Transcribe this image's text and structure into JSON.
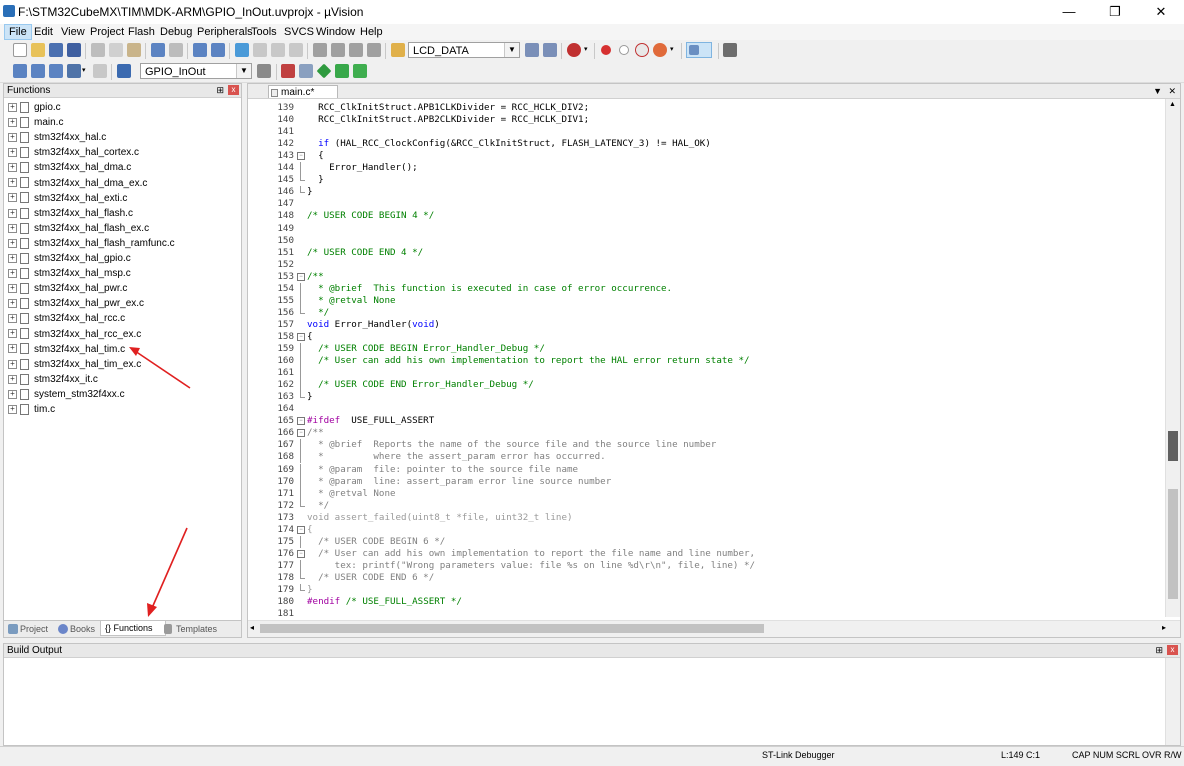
{
  "window": {
    "title": "F:\\STM32CubeMX\\TIM\\MDK-ARM\\GPIO_InOut.uvprojx - µVision",
    "minimize": "—",
    "maximize": "❐",
    "close": "✕"
  },
  "menu": [
    "File",
    "Edit",
    "View",
    "Project",
    "Flash",
    "Debug",
    "Peripherals",
    "Tools",
    "SVCS",
    "Window",
    "Help"
  ],
  "toolbar1": {
    "combo_value": "LCD_DATA"
  },
  "toolbar2": {
    "target_value": "GPIO_InOut"
  },
  "functions_panel": {
    "title": "Functions",
    "pin": "⊞",
    "close": "x",
    "files": [
      "gpio.c",
      "main.c",
      "stm32f4xx_hal.c",
      "stm32f4xx_hal_cortex.c",
      "stm32f4xx_hal_dma.c",
      "stm32f4xx_hal_dma_ex.c",
      "stm32f4xx_hal_exti.c",
      "stm32f4xx_hal_flash.c",
      "stm32f4xx_hal_flash_ex.c",
      "stm32f4xx_hal_flash_ramfunc.c",
      "stm32f4xx_hal_gpio.c",
      "stm32f4xx_hal_msp.c",
      "stm32f4xx_hal_pwr.c",
      "stm32f4xx_hal_pwr_ex.c",
      "stm32f4xx_hal_rcc.c",
      "stm32f4xx_hal_rcc_ex.c",
      "stm32f4xx_hal_tim.c",
      "stm32f4xx_hal_tim_ex.c",
      "stm32f4xx_it.c",
      "system_stm32f4xx.c",
      "tim.c"
    ],
    "tabs": [
      {
        "label": "Project",
        "color": "#7a9bbf"
      },
      {
        "label": "Books",
        "color": "#6a85c9"
      },
      {
        "label": "{} Functions",
        "color": "#ffffff"
      },
      {
        "label": "Templates",
        "color": "#9a9a9a"
      }
    ]
  },
  "editor": {
    "tab_label": "main.c*",
    "menu_btn": "▼",
    "close_btn": "✕",
    "lines": [
      {
        "n": "139",
        "fold": "",
        "html": "  RCC_ClkInitStruct.APB1CLKDivider = RCC_HCLK_DIV2;"
      },
      {
        "n": "140",
        "fold": "",
        "html": "  RCC_ClkInitStruct.APB2CLKDivider = RCC_HCLK_DIV1;"
      },
      {
        "n": "141",
        "fold": "",
        "html": ""
      },
      {
        "n": "142",
        "fold": "",
        "html": "  <span class='kw'>if</span> (HAL_RCC_ClockConfig(&RCC_ClkInitStruct, FLASH_LATENCY_3) != HAL_OK)"
      },
      {
        "n": "143",
        "fold": "box",
        "html": "  {"
      },
      {
        "n": "144",
        "fold": "line",
        "html": "    Error_Handler();"
      },
      {
        "n": "145",
        "fold": "end",
        "html": "  }"
      },
      {
        "n": "146",
        "fold": "end",
        "html": "}"
      },
      {
        "n": "147",
        "fold": "",
        "html": ""
      },
      {
        "n": "148",
        "fold": "",
        "html": "<span class='cm'>/* USER CODE BEGIN 4 */</span>"
      },
      {
        "n": "149",
        "fold": "",
        "html": ""
      },
      {
        "n": "150",
        "fold": "",
        "html": ""
      },
      {
        "n": "151",
        "fold": "",
        "html": "<span class='cm'>/* USER CODE END 4 */</span>"
      },
      {
        "n": "152",
        "fold": "",
        "html": ""
      },
      {
        "n": "153",
        "fold": "box",
        "html": "<span class='cm'>/**</span>"
      },
      {
        "n": "154",
        "fold": "line",
        "html": "<span class='cm'>  * @brief  This function is executed in case of error occurrence.</span>"
      },
      {
        "n": "155",
        "fold": "line",
        "html": "<span class='cm'>  * @retval None</span>"
      },
      {
        "n": "156",
        "fold": "end",
        "html": "<span class='cm'>  */</span>"
      },
      {
        "n": "157",
        "fold": "",
        "html": "<span class='kw'>void</span> Error_Handler(<span class='kw'>void</span>)"
      },
      {
        "n": "158",
        "fold": "box",
        "html": "{"
      },
      {
        "n": "159",
        "fold": "line",
        "html": "  <span class='cm'>/* USER CODE BEGIN Error_Handler_Debug */</span>"
      },
      {
        "n": "160",
        "fold": "line",
        "html": "  <span class='cm'>/* User can add his own implementation to report the HAL error return state */</span>"
      },
      {
        "n": "161",
        "fold": "line",
        "html": ""
      },
      {
        "n": "162",
        "fold": "line",
        "html": "  <span class='cm'>/* USER CODE END Error_Handler_Debug */</span>"
      },
      {
        "n": "163",
        "fold": "end",
        "html": "}"
      },
      {
        "n": "164",
        "fold": "",
        "html": ""
      },
      {
        "n": "165",
        "fold": "box",
        "html": "<span class='pp'>#ifdef</span>  USE_FULL_ASSERT"
      },
      {
        "n": "166",
        "fold": "box",
        "html": "<span class='cm-g'>/**</span>"
      },
      {
        "n": "167",
        "fold": "line",
        "html": "<span class='cm-g'>  * @brief  Reports the name of the source file and the source line number</span>"
      },
      {
        "n": "168",
        "fold": "line",
        "html": "<span class='cm-g'>  *         where the assert_param error has occurred.</span>"
      },
      {
        "n": "169",
        "fold": "line",
        "html": "<span class='cm-g'>  * @param  file: pointer to the source file name</span>"
      },
      {
        "n": "170",
        "fold": "line",
        "html": "<span class='cm-g'>  * @param  line: assert_param error line source number</span>"
      },
      {
        "n": "171",
        "fold": "line",
        "html": "<span class='cm-g'>  * @retval None</span>"
      },
      {
        "n": "172",
        "fold": "end",
        "html": "<span class='cm-g'>  */</span>"
      },
      {
        "n": "173",
        "fold": "",
        "html": "<span class='dim'>void assert_failed(uint8_t *file, uint32_t line)</span>"
      },
      {
        "n": "174",
        "fold": "box",
        "html": "<span class='dim'>{</span>"
      },
      {
        "n": "175",
        "fold": "line",
        "html": "  <span class='cm-g'>/* USER CODE BEGIN 6 */</span>"
      },
      {
        "n": "176",
        "fold": "box",
        "html": "  <span class='cm-g'>/* User can add his own implementation to report the file name and line number,</span>"
      },
      {
        "n": "177",
        "fold": "line",
        "html": "<span class='cm-g'>     tex: printf(\"Wrong parameters value: file %s on line %d\\r\\n\", file, line) */</span>"
      },
      {
        "n": "178",
        "fold": "end",
        "html": "  <span class='cm-g'>/* USER CODE END 6 */</span>"
      },
      {
        "n": "179",
        "fold": "end",
        "html": "<span class='dim'>}</span>"
      },
      {
        "n": "180",
        "fold": "",
        "html": "<span class='pp'>#endif</span> <span class='cm'>/* USE_FULL_ASSERT */</span>"
      },
      {
        "n": "181",
        "fold": "",
        "html": ""
      }
    ]
  },
  "build_output": {
    "title": "Build Output",
    "pin": "⊞",
    "close": "x"
  },
  "status": {
    "debugger": "ST-Link Debugger",
    "position": "L:149 C:1",
    "caps": "CAP  NUM  SCRL  OVR  R/W"
  }
}
